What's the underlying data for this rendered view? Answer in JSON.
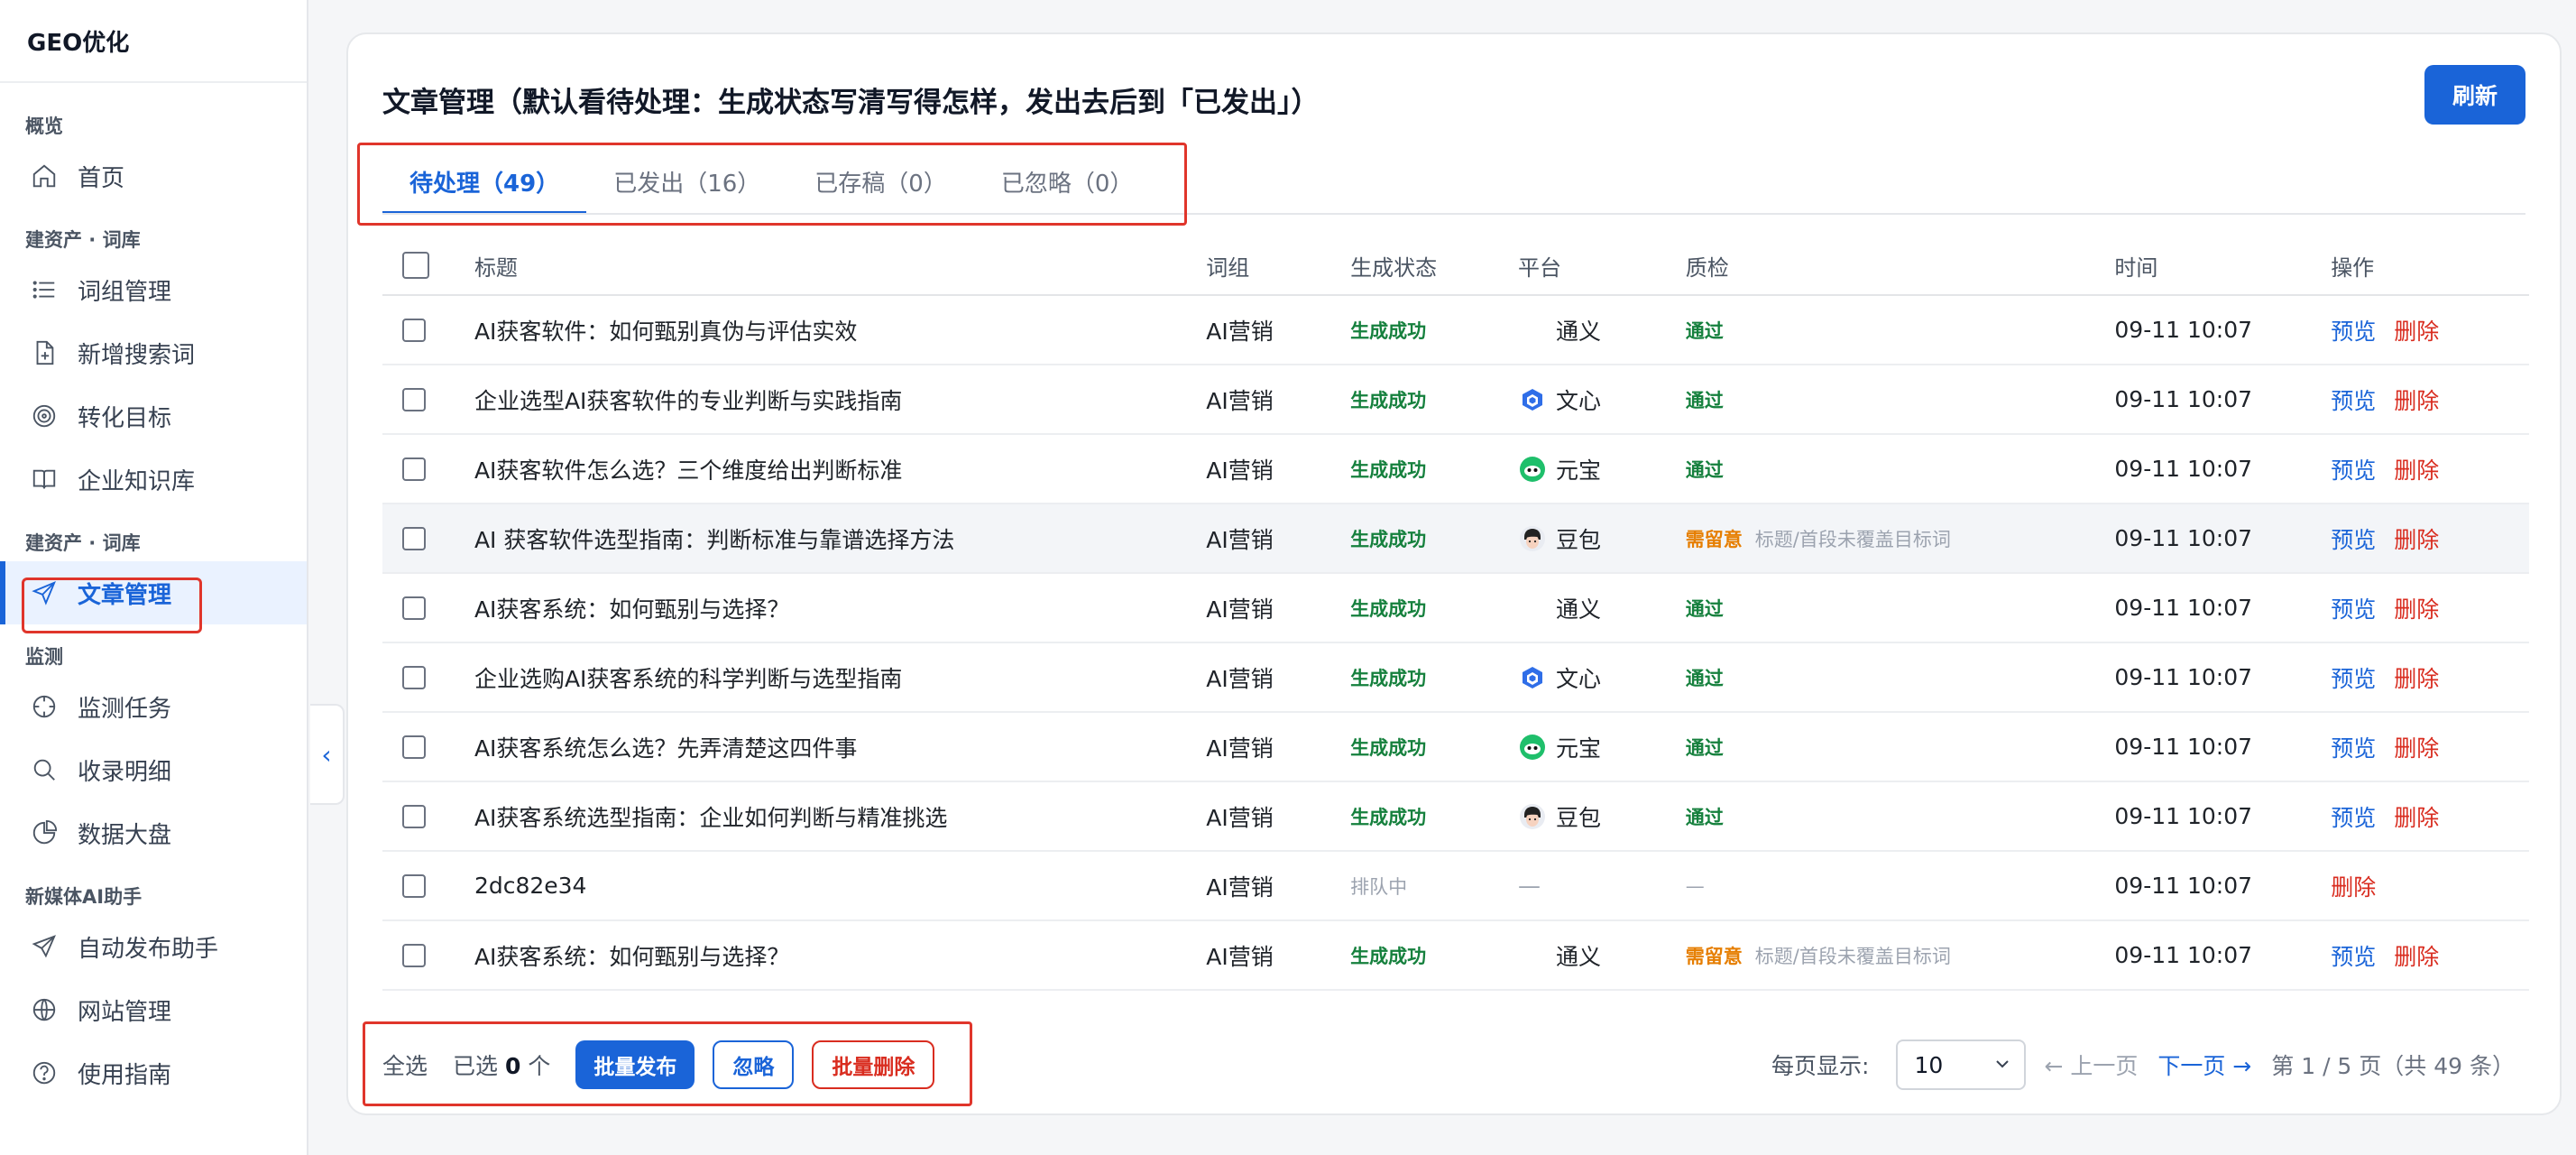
{
  "brand": "GEO优化",
  "sidebar": {
    "groups": [
      {
        "title": "概览",
        "items": [
          {
            "label": "首页"
          }
        ]
      },
      {
        "title": "建资产 · 词库",
        "items": [
          {
            "label": "词组管理"
          },
          {
            "label": "新增搜索词"
          },
          {
            "label": "转化目标"
          },
          {
            "label": "企业知识库"
          }
        ]
      },
      {
        "title": "建资产 · 词库",
        "items": [
          {
            "label": "文章管理"
          }
        ]
      },
      {
        "title": "监测",
        "items": [
          {
            "label": "监测任务"
          },
          {
            "label": "收录明细"
          },
          {
            "label": "数据大盘"
          }
        ]
      },
      {
        "title": "新媒体AI助手",
        "items": [
          {
            "label": "自动发布助手"
          },
          {
            "label": "网站管理"
          },
          {
            "label": "使用指南"
          }
        ]
      }
    ],
    "collapse_icon": "chevron-left-icon"
  },
  "header": {
    "title": "文章管理（默认看待处理：生成状态写清写得怎样，发出去后到「已发出」）",
    "refresh_label": "刷新"
  },
  "tabs": [
    {
      "label": "待处理（49）",
      "active": true
    },
    {
      "label": "已发出（16）"
    },
    {
      "label": "已存稿（0）"
    },
    {
      "label": "已忽略（0）"
    }
  ],
  "table": {
    "columns": {
      "title": "标题",
      "group": "词组",
      "status": "生成状态",
      "platform": "平台",
      "qc": "质检",
      "time": "时间",
      "ops": "操作"
    },
    "rows": [
      {
        "title": "AI获客软件：如何甄别真伪与评估实效",
        "group": "AI营销",
        "status": "生成成功",
        "platform": "通义",
        "platform_icon": "",
        "qc": "通过",
        "qc_note": "",
        "time": "09-11 10:07",
        "preview": "预览",
        "delete": "删除"
      },
      {
        "title": "企业选型AI获客软件的专业判断与实践指南",
        "group": "AI营销",
        "status": "生成成功",
        "platform": "文心",
        "platform_icon": "wenxin",
        "qc": "通过",
        "qc_note": "",
        "time": "09-11 10:07",
        "preview": "预览",
        "delete": "删除"
      },
      {
        "title": "AI获客软件怎么选？三个维度给出判断标准",
        "group": "AI营销",
        "status": "生成成功",
        "platform": "元宝",
        "platform_icon": "yuanbao",
        "qc": "通过",
        "qc_note": "",
        "time": "09-11 10:07",
        "preview": "预览",
        "delete": "删除"
      },
      {
        "title": "AI 获客软件选型指南：判断标准与靠谱选择方法",
        "group": "AI营销",
        "status": "生成成功",
        "platform": "豆包",
        "platform_icon": "doubao",
        "qc": "需留意",
        "qc_note": "标题/首段未覆盖目标词",
        "time": "09-11 10:07",
        "preview": "预览",
        "delete": "删除",
        "hover": true
      },
      {
        "title": "AI获客系统：如何甄别与选择？",
        "group": "AI营销",
        "status": "生成成功",
        "platform": "通义",
        "platform_icon": "",
        "qc": "通过",
        "qc_note": "",
        "time": "09-11 10:07",
        "preview": "预览",
        "delete": "删除"
      },
      {
        "title": "企业选购AI获客系统的科学判断与选型指南",
        "group": "AI营销",
        "status": "生成成功",
        "platform": "文心",
        "platform_icon": "wenxin",
        "qc": "通过",
        "qc_note": "",
        "time": "09-11 10:07",
        "preview": "预览",
        "delete": "删除"
      },
      {
        "title": "AI获客系统怎么选？先弄清楚这四件事",
        "group": "AI营销",
        "status": "生成成功",
        "platform": "元宝",
        "platform_icon": "yuanbao",
        "qc": "通过",
        "qc_note": "",
        "time": "09-11 10:07",
        "preview": "预览",
        "delete": "删除"
      },
      {
        "title": "AI获客系统选型指南：企业如何判断与精准挑选",
        "group": "AI营销",
        "status": "生成成功",
        "platform": "豆包",
        "platform_icon": "doubao",
        "qc": "通过",
        "qc_note": "",
        "time": "09-11 10:07",
        "preview": "预览",
        "delete": "删除"
      },
      {
        "title": "2dc82e34",
        "group": "AI营销",
        "status": "排队中",
        "platform": "—",
        "platform_icon": "",
        "qc": "—",
        "qc_note": "",
        "time": "09-11 10:07",
        "preview": "",
        "delete": "删除",
        "queue": true
      },
      {
        "title": "AI获客系统：如何甄别与选择？",
        "group": "AI营销",
        "status": "生成成功",
        "platform": "通义",
        "platform_icon": "",
        "qc": "需留意",
        "qc_note": "标题/首段未覆盖目标词",
        "time": "09-11 10:07",
        "preview": "预览",
        "delete": "删除"
      }
    ]
  },
  "footer": {
    "select_all": "全选",
    "selected_prefix": "已选",
    "selected_count": "0",
    "selected_suffix": "个",
    "publish_label": "批量发布",
    "ignore_label": "忽略",
    "batch_delete_label": "批量删除",
    "page_size_label": "每页显示:",
    "page_size": "10",
    "prev_label": "← 上一页",
    "next_label": "下一页 →",
    "page_info": "第 1 / 5 页（共 49 条）"
  },
  "colors": {
    "accent": "#1a64d8",
    "success": "#15803d",
    "warning": "#e67e00",
    "danger": "#d92d20",
    "highlight_box": "#e0352b"
  }
}
